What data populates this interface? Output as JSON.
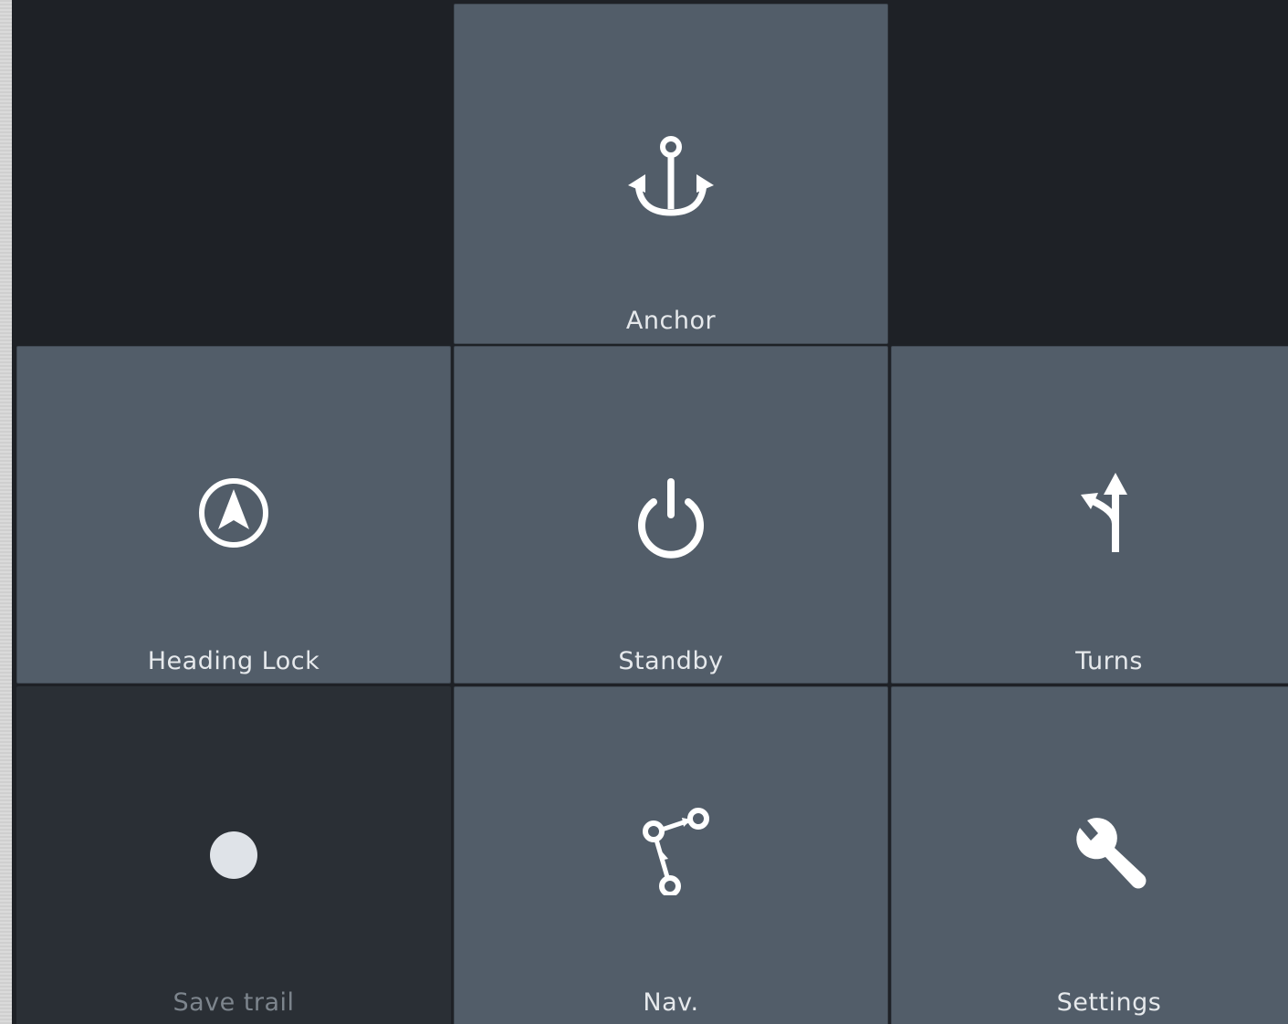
{
  "tiles": {
    "anchor": {
      "label": "Anchor",
      "icon": "anchor-icon"
    },
    "heading_lock": {
      "label": "Heading Lock",
      "icon": "navigation-arrow-icon"
    },
    "standby": {
      "label": "Standby",
      "icon": "power-icon"
    },
    "turns": {
      "label": "Turns",
      "icon": "turn-arrow-icon"
    },
    "save_trail": {
      "label": "Save trail",
      "icon": "record-dot-icon"
    },
    "nav": {
      "label": "Nav.",
      "icon": "route-icon"
    },
    "settings": {
      "label": "Settings",
      "icon": "wrench-icon"
    }
  },
  "colors": {
    "background": "#1e2126",
    "tile": "#525d69",
    "tile_disabled": "#2a2f35",
    "icon": "#ffffff",
    "label": "#e6e9ec",
    "label_disabled": "#7d858d"
  }
}
